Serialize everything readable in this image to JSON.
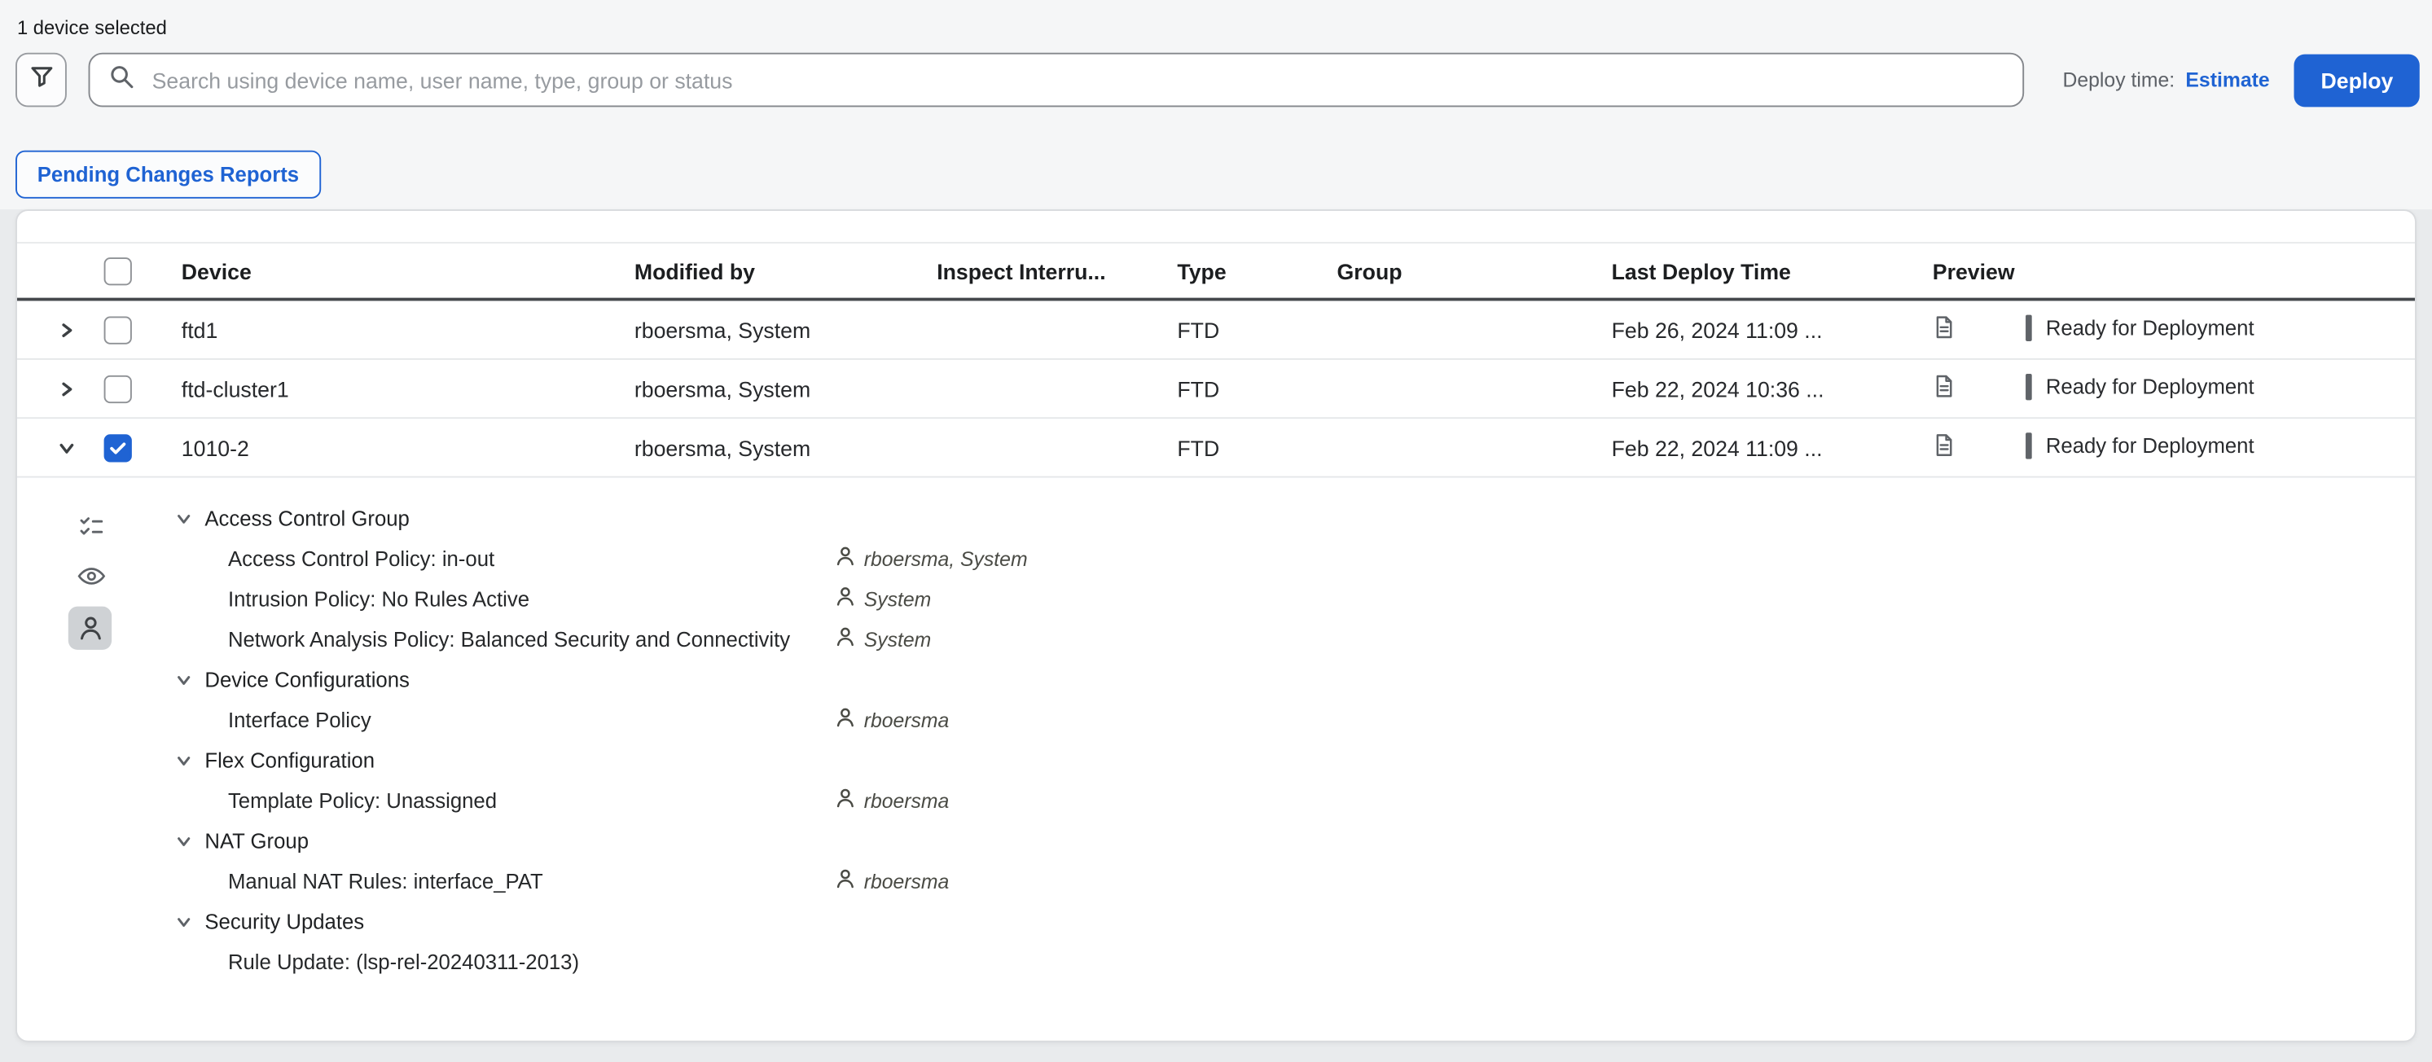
{
  "colors": {
    "accent": "#1f63d3",
    "status_bar": "#5f6368"
  },
  "toolbar": {
    "selected_text": "1 device selected",
    "search_placeholder": "Search using device name, user name, type, group or status",
    "deploy_time_label": "Deploy time:",
    "estimate_link": "Estimate",
    "deploy_button": "Deploy",
    "pending_changes_button": "Pending Changes Reports"
  },
  "table": {
    "columns": {
      "device": "Device",
      "modified_by": "Modified by",
      "inspect": "Inspect Interru...",
      "type": "Type",
      "group": "Group",
      "last_deploy": "Last Deploy Time",
      "preview": "Preview"
    },
    "rows": [
      {
        "device": "ftd1",
        "modified_by": "rboersma, System",
        "type": "FTD",
        "group": "",
        "last_deploy": "Feb 26, 2024 11:09 ...",
        "status": "Ready for Deployment"
      },
      {
        "device": "ftd-cluster1",
        "modified_by": "rboersma, System",
        "type": "FTD",
        "group": "",
        "last_deploy": "Feb 22, 2024 10:36 ...",
        "status": "Ready for Deployment"
      },
      {
        "device": "1010-2",
        "modified_by": "rboersma, System",
        "type": "FTD",
        "group": "",
        "last_deploy": "Feb 22, 2024 11:09 ...",
        "status": "Ready for Deployment"
      }
    ]
  },
  "detail": {
    "groups": [
      {
        "label": "Access Control Group",
        "items": [
          {
            "label": "Access Control Policy: in-out",
            "author": "rboersma, System"
          },
          {
            "label": "Intrusion Policy: No Rules Active",
            "author": "System"
          },
          {
            "label": "Network Analysis Policy: Balanced Security and Connectivity",
            "author": "System"
          }
        ]
      },
      {
        "label": "Device Configurations",
        "items": [
          {
            "label": "Interface Policy",
            "author": "rboersma"
          }
        ]
      },
      {
        "label": "Flex Configuration",
        "items": [
          {
            "label": "Template Policy: Unassigned",
            "author": "rboersma"
          }
        ]
      },
      {
        "label": "NAT Group",
        "items": [
          {
            "label": "Manual NAT Rules: interface_PAT",
            "author": "rboersma"
          }
        ]
      },
      {
        "label": "Security Updates",
        "items": [
          {
            "label": "Rule Update: (lsp-rel-20240311-2013)",
            "author": ""
          }
        ]
      }
    ]
  }
}
